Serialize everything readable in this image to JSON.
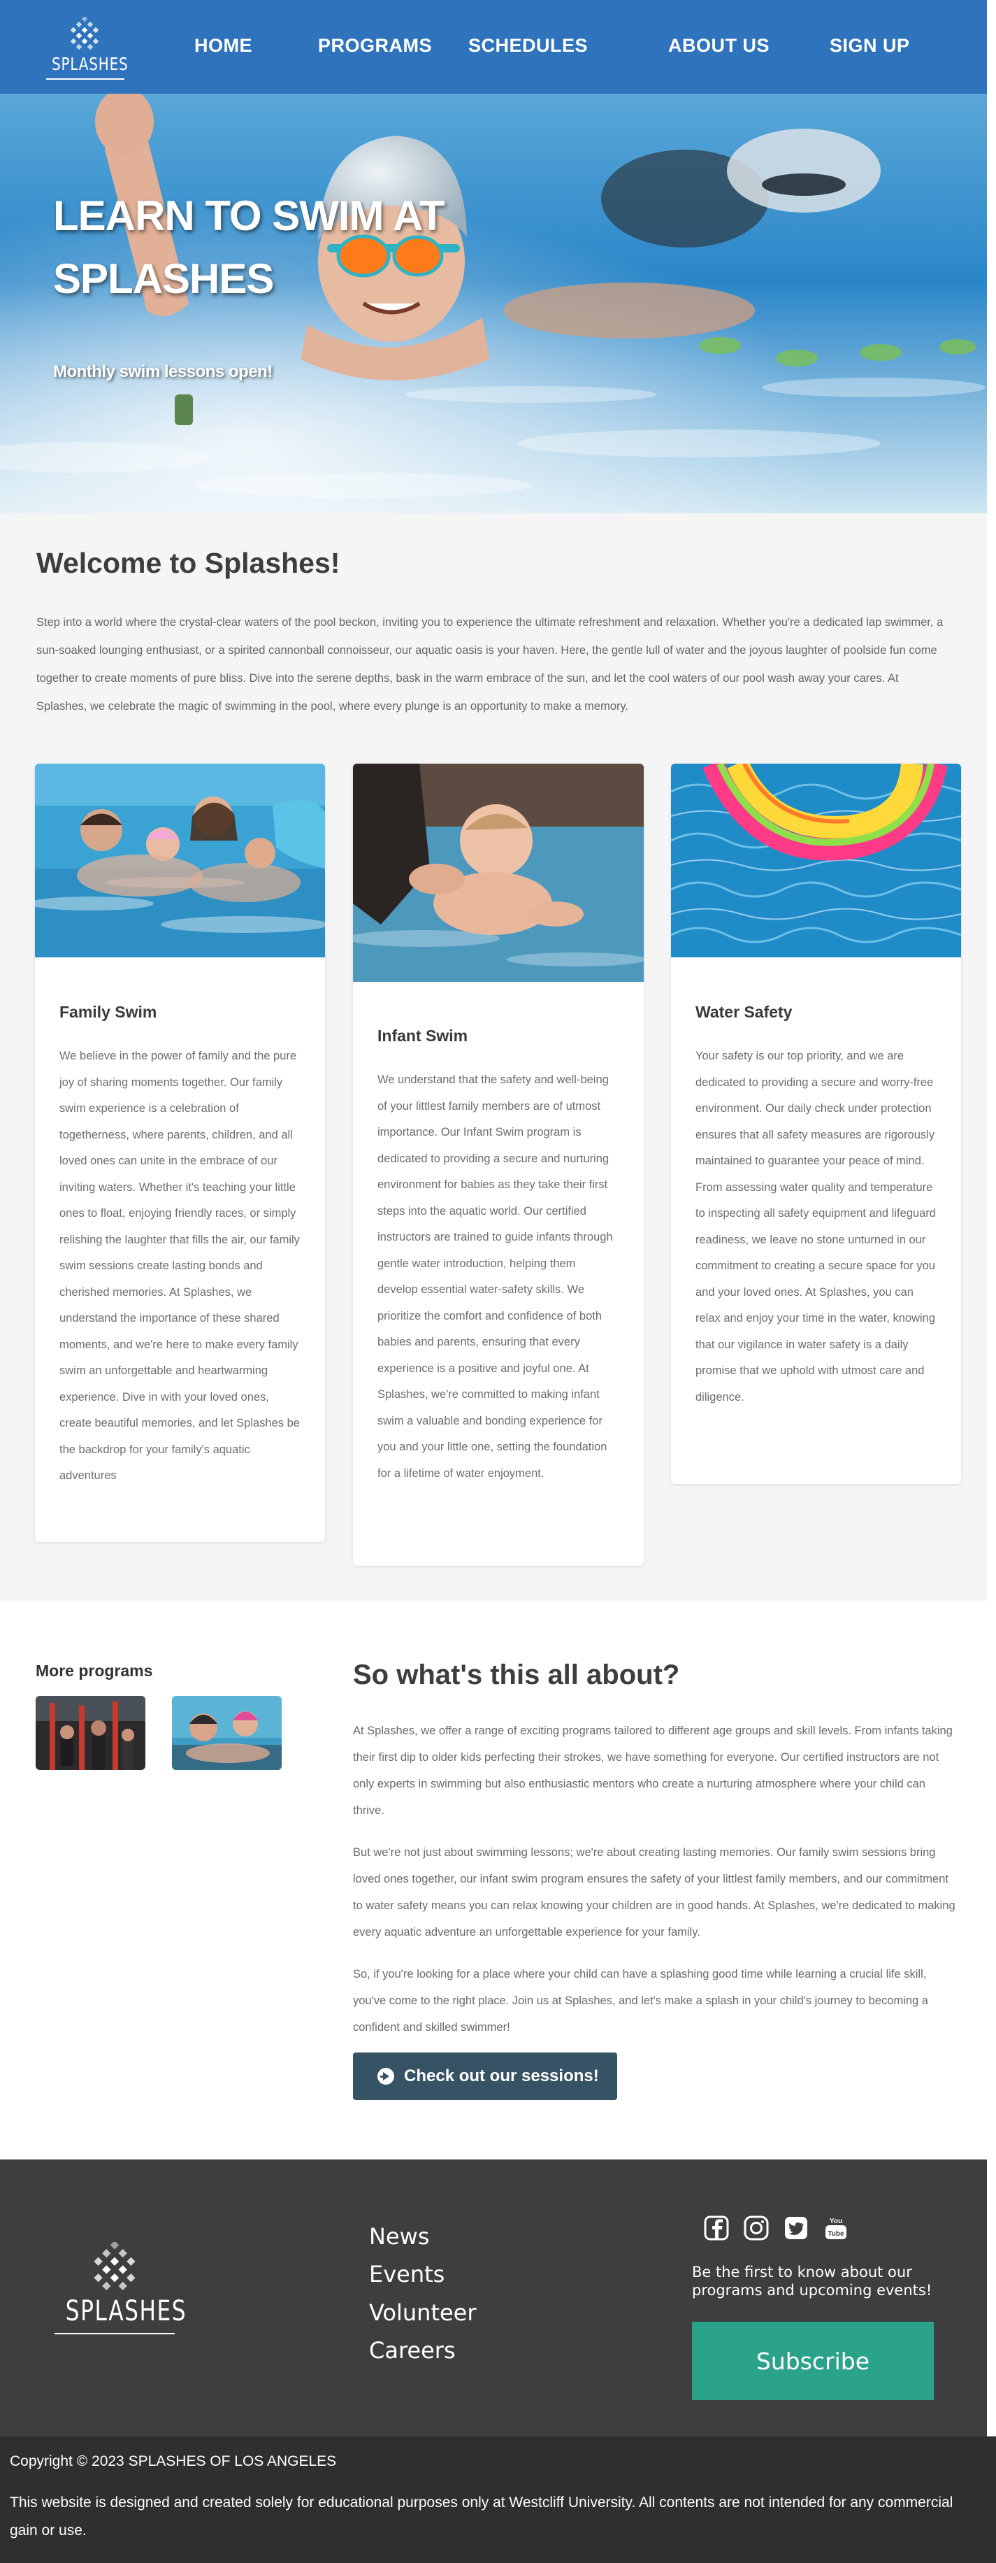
{
  "brand": {
    "name": "SPLASHES",
    "primary_color": "#2f73bd",
    "accent_color": "#2aa38a"
  },
  "nav": {
    "items": [
      {
        "label": "HOME"
      },
      {
        "label": "PROGRAMS"
      },
      {
        "label": "SCHEDULES"
      },
      {
        "label": "ABOUT US"
      },
      {
        "label": "SIGN UP"
      }
    ]
  },
  "hero": {
    "title": "LEARN TO SWIM AT SPLASHES",
    "subtitle": "Monthly swim lessons open!"
  },
  "welcome": {
    "title": "Welcome to Splashes!",
    "text": "Step into a world where the crystal-clear waters of the pool beckon, inviting you to experience the ultimate refreshment and relaxation. Whether you're a dedicated lap swimmer, a sun-soaked lounging enthusiast, or a spirited cannonball connoisseur, our aquatic oasis is your haven. Here, the gentle lull of water and the joyous laughter of poolside fun come together to create moments of pure bliss. Dive into the serene depths, bask in the warm embrace of the sun, and let the cool waters of our pool wash away your cares. At Splashes, we celebrate the magic of swimming in the pool, where every plunge is an opportunity to make a memory."
  },
  "cards": [
    {
      "title": "Family Swim",
      "text": "We believe in the power of family and the pure joy of sharing moments together. Our family swim experience is a celebration of togetherness, where parents, children, and all loved ones can unite in the embrace of our inviting waters. Whether it's teaching your little ones to float, enjoying friendly races, or simply relishing the laughter that fills the air, our family swim sessions create lasting bonds and cherished memories. At Splashes, we understand the importance of these shared moments, and we're here to make every family swim an unforgettable and heartwarming experience. Dive in with your loved ones, create beautiful memories, and let Splashes be the backdrop for your family's aquatic adventures"
    },
    {
      "title": "Infant Swim",
      "text": "We understand that the safety and well-being of your littlest family members are of utmost importance. Our Infant Swim program is dedicated to providing a secure and nurturing environment for babies as they take their first steps into the aquatic world. Our certified instructors are trained to guide infants through gentle water introduction, helping them develop essential water-safety skills. We prioritize the comfort and confidence of both babies and parents, ensuring that every experience is a positive and joyful one. At Splashes, we're committed to making infant swim a valuable and bonding experience for you and your little one, setting the foundation for a lifetime of water enjoyment."
    },
    {
      "title": "Water Safety",
      "text": "Your safety is our top priority, and we are dedicated to providing a secure and worry-free environment. Our daily check under protection ensures that all safety measures are rigorously maintained to guarantee your peace of mind. From assessing water quality and temperature to inspecting all safety equipment and lifeguard readiness, we leave no stone unturned in our commitment to creating a secure space for you and your loved ones. At Splashes, you can relax and enjoy your time in the water, knowing that our vigilance in water safety is a daily promise that we uphold with utmost care and diligence."
    }
  ],
  "more_programs": {
    "title": "More programs"
  },
  "about": {
    "title": "So what's this all about?",
    "paragraphs": [
      "At Splashes, we offer a range of exciting programs tailored to different age groups and skill levels. From infants taking their first dip to older kids perfecting their strokes, we have something for everyone. Our certified instructors are not only experts in swimming but also enthusiastic mentors who create a nurturing atmosphere where your child can thrive.",
      "But we're not just about swimming lessons; we're about creating lasting memories. Our family swim sessions bring loved ones together, our infant swim program ensures the safety of your littlest family members, and our commitment to water safety means you can relax knowing your children are in good hands. At Splashes, we're dedicated to making every aquatic adventure an unforgettable experience for your family.",
      "So, if you're looking for a place where your child can have a splashing good time while learning a crucial life skill, you've come to the right place. Join us at Splashes, and let's make a splash in your child's journey to becoming a confident and skilled swimmer!"
    ],
    "cta_label": "Check out our sessions!"
  },
  "footer": {
    "links": [
      {
        "label": "News"
      },
      {
        "label": "Events"
      },
      {
        "label": "Volunteer"
      },
      {
        "label": "Careers"
      }
    ],
    "social_icons": [
      "facebook-icon",
      "instagram-icon",
      "twitter-icon",
      "youtube-icon"
    ],
    "note": "Be the first to know about our programs and upcoming events!",
    "subscribe_label": "Subscribe",
    "copyright": "Copyright © 2023 SPLASHES OF LOS ANGELES",
    "disclaimer": "This website is designed and created solely for educational purposes only at Westcliff University. All contents are not intended for any commercial gain or use."
  }
}
